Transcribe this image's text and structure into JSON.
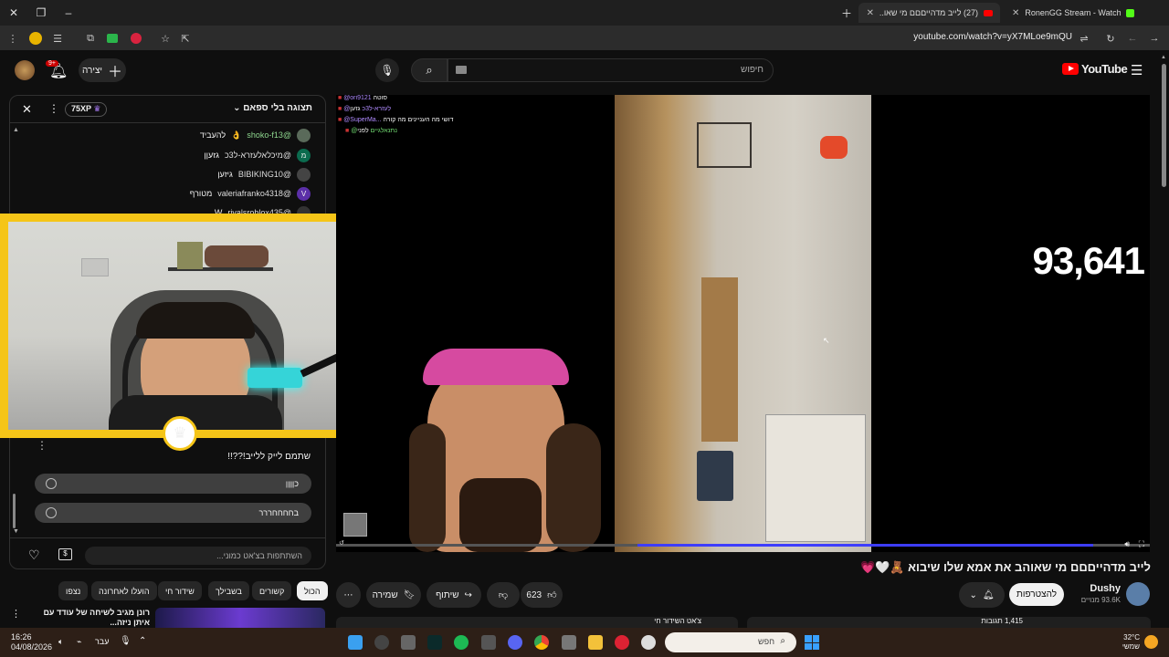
{
  "browser": {
    "tabs": [
      {
        "title": "(27) לייב מדהייםםם מי שאו...",
        "active": true
      },
      {
        "title": "RonenGG Stream - Watch Live ...",
        "active": false
      }
    ],
    "url": "youtube.com/watch?v=yX7MLoe9mQU"
  },
  "header": {
    "search_placeholder": "חיפוש",
    "create_label": "יצירה",
    "notifications_count": "9+",
    "logo_text": "YouTube"
  },
  "chat": {
    "header_label": "תצוגה בלי ספאם",
    "xp_badge": "75XP",
    "messages": [
      {
        "user": "@shoko-f13",
        "text": "להעביד",
        "avatar_color": "#5a6a5a",
        "initial": ""
      },
      {
        "user": "@מיכלאלעזרא-ל3כ",
        "text": "גזעןן",
        "avatar_color": "#0b6b4e",
        "initial": "מ"
      },
      {
        "user": "@BIBIKING10",
        "text": "גיזען",
        "avatar_color": "#444",
        "initial": ""
      },
      {
        "user": "@valeriafranko4318",
        "text": "מטורף",
        "avatar_color": "#5b2fa8",
        "initial": "V"
      },
      {
        "user": "@rivalsroblox435",
        "text": "W",
        "avatar_color": "#333",
        "initial": ""
      }
    ],
    "poll_question": "שתמם לייק ללייב!??!!",
    "poll_options": [
      "כןןןן",
      "בחחחחררר"
    ],
    "input_placeholder": "השתתפות בצ'אט כמוני..."
  },
  "player": {
    "overlay_chat": [
      {
        "user": "@ori9121",
        "text": "סוטה"
      },
      {
        "user": "@לעזרא-ל3כ",
        "text": "גזען"
      },
      {
        "user": "@SuperMa...",
        "text": "דושי מה העניינים מה קורה"
      },
      {
        "user": "@נתנאלגיים",
        "text": "לפני"
      }
    ],
    "counter": "93,641",
    "progress": 0.93
  },
  "video": {
    "title": "לייב מדהייםםם מי שאוהב את אמא שלו שיבוא 🧸🤍💗",
    "channel_name": "Dushy",
    "subscribers": "93.6K מנויים",
    "subscribe_label": "להצטרפות",
    "likes": "623",
    "share_label": "שיתוף",
    "save_label": "שמירה"
  },
  "chips": [
    "הכול",
    "קשורים",
    "בשבילך",
    "שידור חי",
    "הועלו לאחרונה",
    "נצפו"
  ],
  "recommendation": {
    "title": "רונן מגיב לשיחה של עודד עם איתן ניזה...",
    "comments_header": "1,415 תגובות",
    "below_text": "צ'אט השידור חי"
  },
  "taskbar": {
    "time": "16:26",
    "date": "04/08/2026",
    "language": "עבר",
    "search_placeholder": "חפש",
    "weather_temp": "32°C",
    "weather_text": "שמשי"
  }
}
